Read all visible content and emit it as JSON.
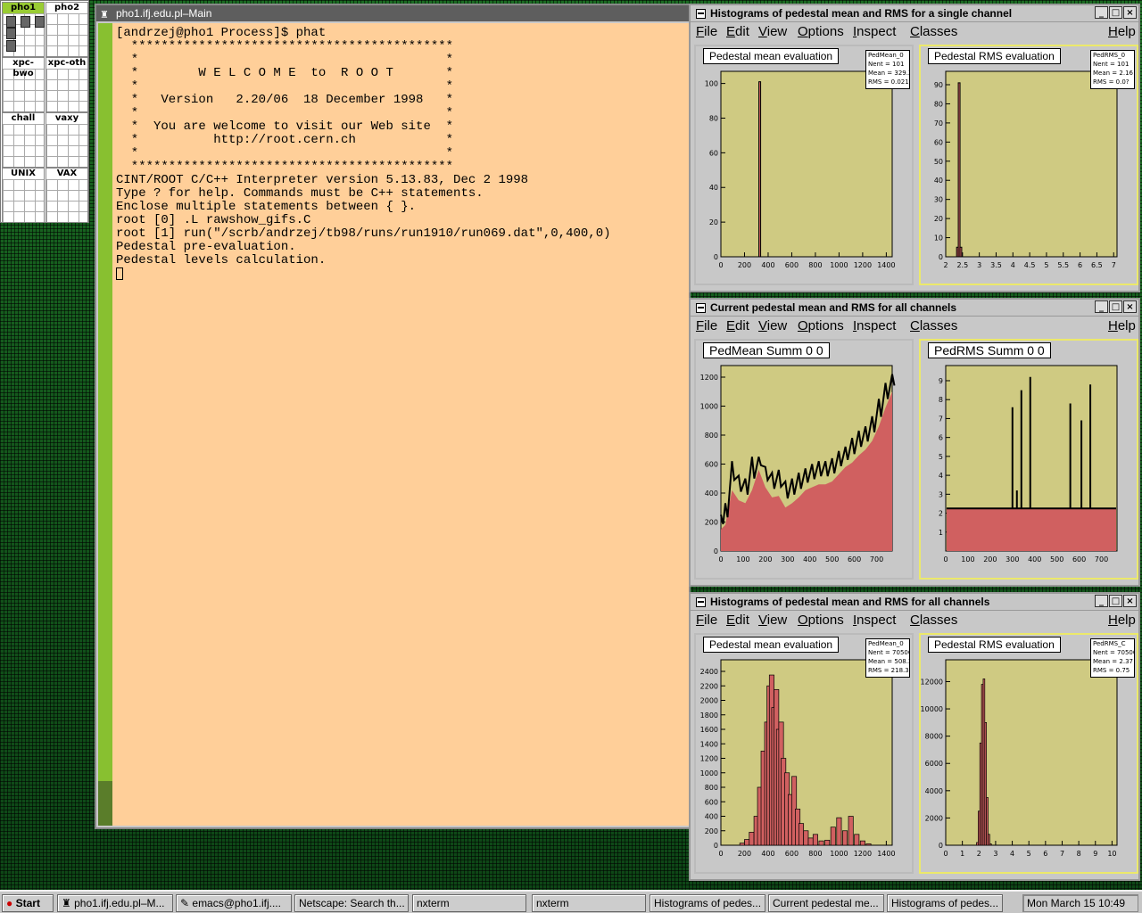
{
  "pager": {
    "desks": [
      {
        "label": "pho1",
        "active": true
      },
      {
        "label": "pho2",
        "active": false
      },
      {
        "label": "xpc-bwo",
        "active": false
      },
      {
        "label": "xpc-oth",
        "active": false
      },
      {
        "label": "chall",
        "active": false
      },
      {
        "label": "vaxy",
        "active": false
      },
      {
        "label": "UNIX",
        "active": false
      },
      {
        "label": "VAX",
        "active": false
      }
    ]
  },
  "terminal": {
    "title": "pho1.ifj.edu.pl–Main",
    "lines": [
      "[andrzej@pho1 Process]$ phat",
      "  *******************************************",
      "  *                                         *",
      "  *        W E L C O M E  to  R O O T       *",
      "  *                                         *",
      "  *   Version   2.20/06  18 December 1998   *",
      "  *                                         *",
      "  *  You are welcome to visit our Web site  *",
      "  *          http://root.cern.ch            *",
      "  *                                         *",
      "  *******************************************",
      "",
      "CINT/ROOT C/C++ Interpreter version 5.13.83, Dec 2 1998",
      "Type ? for help. Commands must be C++ statements.",
      "Enclose multiple statements between { }.",
      "root [0] .L rawshow_gifs.C",
      "root [1] run(\"/scrb/andrzej/tb98/runs/run1910/run069.dat\",0,400,0)",
      "Pedestal pre-evaluation.",
      "Pedestal levels calculation."
    ]
  },
  "menu": [
    "File",
    "Edit",
    "View",
    "Options",
    "Inspect",
    "Classes",
    "Help"
  ],
  "colors": {
    "pad_bg": "#cfca82",
    "hist_fill": "#d06060",
    "line": "#000000",
    "selected_border": "#ece96a"
  },
  "windows": [
    {
      "title": "Histograms of pedestal mean and RMS for a single channel",
      "pads": [
        {
          "title": "Pedestal mean evaluation",
          "stats": [
            "PedMean_0",
            "Nent = 101",
            "Mean = 329.2",
            "RMS = 0.021"
          ]
        },
        {
          "title": "Pedestal RMS evaluation",
          "stats": [
            "PedRMS_0",
            "Nent = 101",
            "Mean = 2.16",
            "RMS = 0.0?"
          ]
        }
      ]
    },
    {
      "title": "Current pedestal mean and RMS for all channels",
      "pads": [
        {
          "title": "PedMean  Summ  0  0",
          "stats": []
        },
        {
          "title": "PedRMS  Summ  0  0",
          "stats": []
        }
      ]
    },
    {
      "title": "Histograms of pedestal mean and RMS for all channels",
      "pads": [
        {
          "title": "Pedestal mean evaluation",
          "stats": [
            "PedMean_0",
            "Nent = 70500",
            "Mean = 508.2",
            "RMS = 218.3"
          ]
        },
        {
          "title": "Pedestal RMS evaluation",
          "stats": [
            "PedRMS_C",
            "Nent = 70500",
            "Mean = 2.37",
            "RMS = 0.75"
          ]
        }
      ]
    }
  ],
  "chart_data": [
    {
      "type": "bar",
      "title": "Pedestal mean evaluation",
      "x_ticks": [
        "0",
        "200",
        "400",
        "600",
        "800",
        "1000",
        "1200",
        "1400"
      ],
      "y_ticks": [
        "0",
        "20",
        "40",
        "60",
        "80",
        "100"
      ],
      "xlim": [
        0,
        1450
      ],
      "ylim": [
        0,
        107
      ],
      "bars": [
        {
          "x": 329,
          "value": 101
        }
      ]
    },
    {
      "type": "bar",
      "title": "Pedestal RMS evaluation",
      "x_ticks": [
        "2",
        "2.5",
        "3",
        "3.5",
        "4",
        "4.5",
        "5",
        "5.5",
        "6",
        "6.5",
        "7"
      ],
      "y_ticks": [
        "0",
        "10",
        "20",
        "30",
        "40",
        "50",
        "60",
        "70",
        "80",
        "90"
      ],
      "xlim": [
        2,
        7.1
      ],
      "ylim": [
        0,
        97
      ],
      "bars": [
        {
          "x": 2.35,
          "value": 5
        },
        {
          "x": 2.4,
          "value": 91
        },
        {
          "x": 2.45,
          "value": 5
        }
      ]
    },
    {
      "type": "area",
      "title": "PedMean  Summ  0  0",
      "x_ticks": [
        "0",
        "100",
        "200",
        "300",
        "400",
        "500",
        "600",
        "700"
      ],
      "y_ticks": [
        "0",
        "200",
        "400",
        "600",
        "800",
        "1000",
        "1200"
      ],
      "xlim": [
        0,
        770
      ],
      "ylim": [
        0,
        1280
      ],
      "x": [
        0,
        20,
        50,
        80,
        110,
        140,
        170,
        200,
        230,
        260,
        290,
        320,
        350,
        380,
        410,
        440,
        470,
        500,
        530,
        560,
        590,
        620,
        650,
        680,
        710,
        740,
        770
      ],
      "values": [
        150,
        180,
        420,
        350,
        330,
        420,
        560,
        440,
        370,
        380,
        300,
        330,
        370,
        420,
        440,
        460,
        460,
        480,
        530,
        580,
        610,
        660,
        700,
        760,
        860,
        990,
        1100
      ],
      "envelope": [
        250,
        330,
        620,
        520,
        500,
        650,
        650,
        580,
        540,
        560,
        480,
        500,
        540,
        570,
        600,
        620,
        620,
        640,
        690,
        720,
        780,
        830,
        860,
        930,
        1050,
        1160,
        1220
      ]
    },
    {
      "type": "area",
      "title": "PedRMS  Summ  0  0",
      "x_ticks": [
        "0",
        "100",
        "200",
        "300",
        "400",
        "500",
        "600",
        "700"
      ],
      "y_ticks": [
        "1",
        "2",
        "3",
        "4",
        "5",
        "6",
        "7",
        "8",
        "9"
      ],
      "xlim": [
        0,
        770
      ],
      "ylim": [
        0,
        9.8
      ],
      "baseline": 2.25,
      "spikes": [
        {
          "x": 300,
          "value": 7.6
        },
        {
          "x": 320,
          "value": 3.2
        },
        {
          "x": 340,
          "value": 8.5
        },
        {
          "x": 380,
          "value": 9.2
        },
        {
          "x": 560,
          "value": 7.8
        },
        {
          "x": 610,
          "value": 6.9
        },
        {
          "x": 650,
          "value": 8.8
        }
      ]
    },
    {
      "type": "bar",
      "title": "Pedestal mean evaluation",
      "x_ticks": [
        "0",
        "200",
        "400",
        "600",
        "800",
        "1000",
        "1200",
        "1400"
      ],
      "y_ticks": [
        "0",
        "200",
        "400",
        "600",
        "800",
        "1000",
        "1200",
        "1400",
        "1600",
        "1800",
        "2000",
        "2200",
        "2400"
      ],
      "xlim": [
        0,
        1450
      ],
      "ylim": [
        0,
        2560
      ],
      "x": [
        180,
        220,
        260,
        300,
        330,
        360,
        390,
        410,
        430,
        450,
        470,
        490,
        510,
        530,
        560,
        590,
        620,
        650,
        680,
        720,
        760,
        800,
        850,
        900,
        950,
        1000,
        1050,
        1100,
        1150,
        1200,
        1250
      ],
      "values": [
        30,
        80,
        180,
        400,
        800,
        1300,
        1700,
        2200,
        2350,
        1900,
        2150,
        1600,
        1700,
        1200,
        1000,
        700,
        950,
        500,
        300,
        200,
        100,
        150,
        60,
        70,
        250,
        380,
        200,
        400,
        150,
        60,
        20
      ]
    },
    {
      "type": "bar",
      "title": "Pedestal RMS evaluation",
      "x_ticks": [
        "0",
        "1",
        "2",
        "3",
        "4",
        "5",
        "6",
        "7",
        "8",
        "9",
        "10"
      ],
      "y_ticks": [
        "0",
        "2000",
        "4000",
        "6000",
        "8000",
        "10000",
        "12000"
      ],
      "xlim": [
        0,
        10.3
      ],
      "ylim": [
        0,
        13600
      ],
      "x": [
        1.9,
        2.0,
        2.1,
        2.2,
        2.3,
        2.4,
        2.5,
        2.6,
        2.7
      ],
      "values": [
        200,
        2500,
        7500,
        11800,
        12200,
        9000,
        3500,
        800,
        100
      ]
    }
  ],
  "taskbar": {
    "start": "Start",
    "items": [
      "pho1.ifj.edu.pl–M...",
      "emacs@pho1.ifj....",
      "Netscape: Search th...",
      "nxterm",
      "nxterm",
      "Histograms of pedes...",
      "Current pedestal me...",
      "Histograms of pedes..."
    ],
    "clock": "Mon March 15 10:49"
  }
}
